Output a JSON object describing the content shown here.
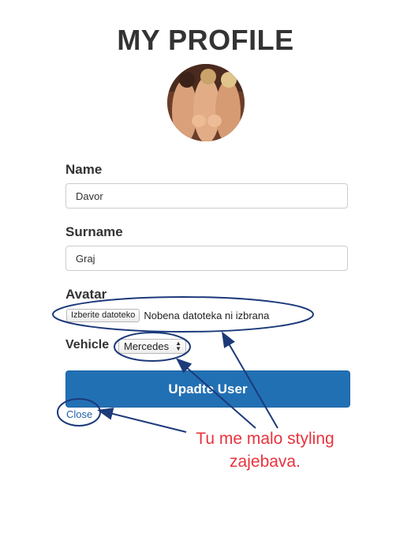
{
  "page": {
    "title": "MY PROFILE"
  },
  "avatar": {
    "icon": "profile-photo"
  },
  "form": {
    "name_label": "Name",
    "name_value": "Davor",
    "surname_label": "Surname",
    "surname_value": "Graj",
    "avatar_label": "Avatar",
    "file_button_label": "Izberite datoteko",
    "file_status": "Nobena datoteka ni izbrana",
    "vehicle_label": "Vehicle",
    "vehicle_selected": "Mercedes",
    "submit_label": "Upadte User",
    "close_label": "Close"
  },
  "annotation": {
    "line1": "Tu me malo styling",
    "line2": "zajebava.",
    "colors": {
      "text": "#e8333d",
      "stroke": "#1c3a7a"
    }
  },
  "colors": {
    "primary": "#2270b4",
    "link": "#1f5fa8"
  }
}
